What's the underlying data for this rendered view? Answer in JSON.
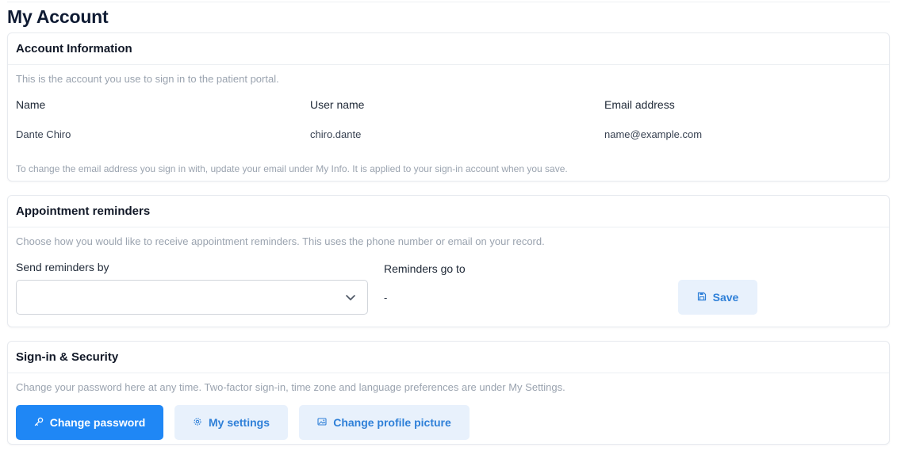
{
  "page": {
    "title": "My Account"
  },
  "account": {
    "header": "Account Information",
    "description": "This is the account you use to sign in to the patient portal.",
    "name_label": "Name",
    "name_value": "Dante Chiro",
    "username_label": "User name",
    "username_value": "chiro.dante",
    "email_label": "Email address",
    "email_value": "name@example.com",
    "note": "To change the email address you sign in with, update your email under My Info. It is applied to your sign-in account when you save."
  },
  "reminders": {
    "header": "Appointment reminders",
    "description": "Choose how you would like to receive appointment reminders. This uses the phone number or email on your record.",
    "send_label": "Send reminders by",
    "send_value": "",
    "go_to_label": "Reminders go to",
    "go_to_value": "-",
    "save_label": "Save"
  },
  "security": {
    "header": "Sign-in & Security",
    "description": "Change your password here at any time. Two-factor sign-in, time zone and language preferences are under My Settings.",
    "change_password_label": "Change password",
    "my_settings_label": "My settings",
    "change_picture_label": "Change profile picture"
  },
  "icons": {
    "select_chevron": "chevron-down-icon",
    "save": "save-icon",
    "change_password": "key-icon",
    "my_settings": "gear-icon",
    "change_picture": "image-icon"
  },
  "colors": {
    "primary": "#1f87f5",
    "soft_button_bg": "#e8f1fc",
    "soft_button_text": "#2f80d8",
    "muted_text": "#9aa3af"
  }
}
